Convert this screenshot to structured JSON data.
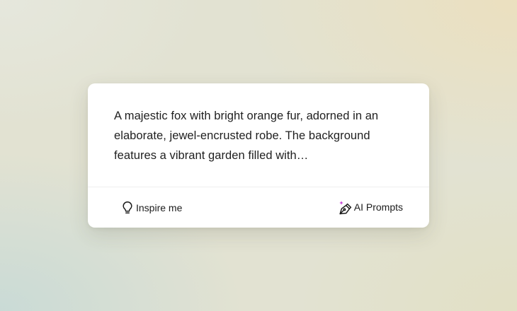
{
  "prompt_card": {
    "text": "A majestic fox with bright orange fur, adorned in an elaborate, jewel-encrusted robe. The background features a vibrant garden filled with…"
  },
  "footer": {
    "inspire_label": "Inspire me",
    "ai_prompts_label": "AI Prompts"
  },
  "icons": {
    "inspire": "lightbulb-icon",
    "ai_prompts": "pen-sparkle-icon"
  },
  "colors": {
    "text": "#1f1f1f",
    "sparkle": "#c43bd6"
  }
}
